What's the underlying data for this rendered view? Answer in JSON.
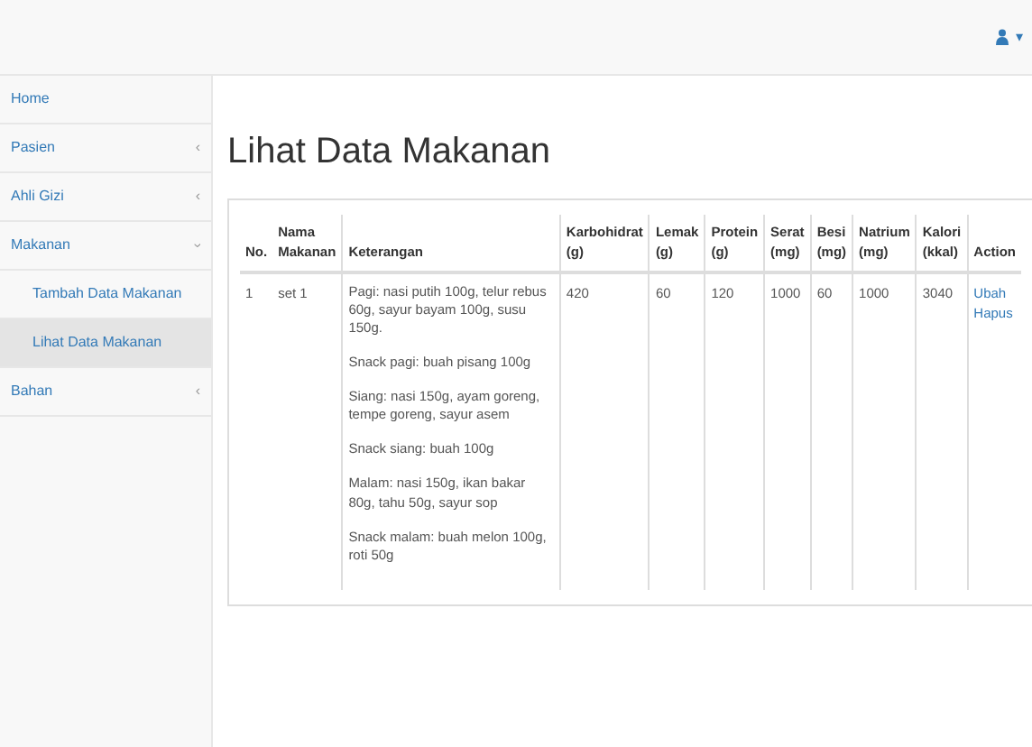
{
  "navbar": {
    "user_menu": "▾"
  },
  "sidebar": {
    "items": [
      {
        "label": "Home",
        "selected": false
      },
      {
        "label": "Pasien",
        "arrow": "‹",
        "selected": false
      },
      {
        "label": "Ahli Gizi",
        "arrow": "‹",
        "selected": false
      },
      {
        "label": "Makanan",
        "arrow": "‹",
        "expanded": true,
        "selected": false,
        "children": [
          {
            "label": "Tambah Data Makanan",
            "selected": false
          },
          {
            "label": "Lihat Data Makanan",
            "selected": true
          }
        ]
      },
      {
        "label": "Bahan",
        "arrow": "‹",
        "selected": false
      }
    ]
  },
  "page_title": "Lihat Data Makanan",
  "table": {
    "columns": [
      "No.",
      "Nama Makanan",
      "Keterangan",
      "Karbohidrat (g)",
      "Lemak (g)",
      "Protein (g)",
      "Serat (mg)",
      "Besi (mg)",
      "Natrium (mg)",
      "Kalori (kkal)",
      "Action"
    ],
    "rows": [
      {
        "no": "1",
        "name": "set 1",
        "notes": [
          "Pagi: nasi putih 100g, telur rebus 60g, sayur bayam 100g, susu 150g.",
          "Snack pagi: buah pisang 100g",
          "Siang: nasi 150g, ayam goreng, tempe goreng, sayur asem",
          "Snack siang: buah 100g",
          "Malam: nasi 150g, ikan bakar 80g, tahu 50g, sayur sop",
          "Snack malam: buah melon 100g, roti 50g"
        ],
        "values": [
          "420",
          "60",
          "120",
          "1000",
          "60",
          "1000",
          "3040"
        ],
        "actions": [
          "Ubah",
          "Hapus"
        ]
      }
    ]
  }
}
